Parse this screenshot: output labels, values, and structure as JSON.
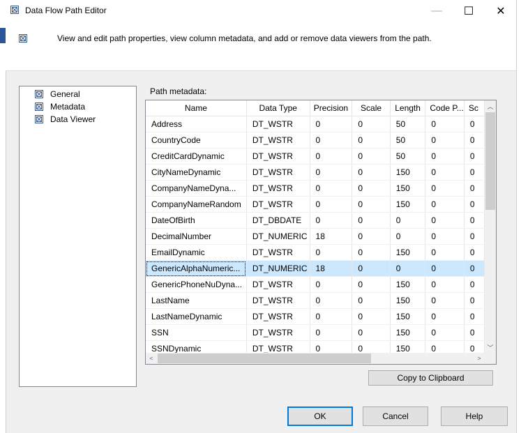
{
  "window": {
    "title": "Data Flow Path Editor",
    "minimize_glyph": "—",
    "maximize_glyph": "☐",
    "close_glyph": "✕"
  },
  "header": {
    "description": "View and edit path properties, view column metadata, and add or remove data viewers from the path."
  },
  "nav": {
    "items": [
      {
        "label": "General",
        "icon": "general-page-icon",
        "selected": false
      },
      {
        "label": "Metadata",
        "icon": "metadata-page-icon",
        "selected": true
      },
      {
        "label": "Data Viewer",
        "icon": "data-viewer-page-icon",
        "selected": false
      }
    ]
  },
  "metadata": {
    "label": "Path metadata:",
    "columns": [
      "Name",
      "Data Type",
      "Precision",
      "Scale",
      "Length",
      "Code P...",
      "Sc"
    ],
    "rows": [
      [
        "Address",
        "DT_WSTR",
        "0",
        "0",
        "50",
        "0",
        "0"
      ],
      [
        "CountryCode",
        "DT_WSTR",
        "0",
        "0",
        "50",
        "0",
        "0"
      ],
      [
        "CreditCardDynamic",
        "DT_WSTR",
        "0",
        "0",
        "50",
        "0",
        "0"
      ],
      [
        "CityNameDynamic",
        "DT_WSTR",
        "0",
        "0",
        "150",
        "0",
        "0"
      ],
      [
        "CompanyNameDyna...",
        "DT_WSTR",
        "0",
        "0",
        "150",
        "0",
        "0"
      ],
      [
        "CompanyNameRandom",
        "DT_WSTR",
        "0",
        "0",
        "150",
        "0",
        "0"
      ],
      [
        "DateOfBirth",
        "DT_DBDATE",
        "0",
        "0",
        "0",
        "0",
        "0"
      ],
      [
        "DecimalNumber",
        "DT_NUMERIC",
        "18",
        "0",
        "0",
        "0",
        "0"
      ],
      [
        "EmailDynamic",
        "DT_WSTR",
        "0",
        "0",
        "150",
        "0",
        "0"
      ],
      [
        "GenericAlphaNumeric...",
        "DT_NUMERIC",
        "18",
        "0",
        "0",
        "0",
        "0"
      ],
      [
        "GenericPhoneNuDyna...",
        "DT_WSTR",
        "0",
        "0",
        "150",
        "0",
        "0"
      ],
      [
        "LastName",
        "DT_WSTR",
        "0",
        "0",
        "150",
        "0",
        "0"
      ],
      [
        "LastNameDynamic",
        "DT_WSTR",
        "0",
        "0",
        "150",
        "0",
        "0"
      ],
      [
        "SSN",
        "DT_WSTR",
        "0",
        "0",
        "150",
        "0",
        "0"
      ],
      [
        "SSNDynamic",
        "DT_WSTR",
        "0",
        "0",
        "150",
        "0",
        "0"
      ]
    ],
    "selected_row": 9
  },
  "buttons": {
    "copy": "Copy to Clipboard",
    "ok": "OK",
    "cancel": "Cancel",
    "help": "Help"
  },
  "colors": {
    "selection": "#cce8ff",
    "default_button_border": "#0078d7"
  }
}
